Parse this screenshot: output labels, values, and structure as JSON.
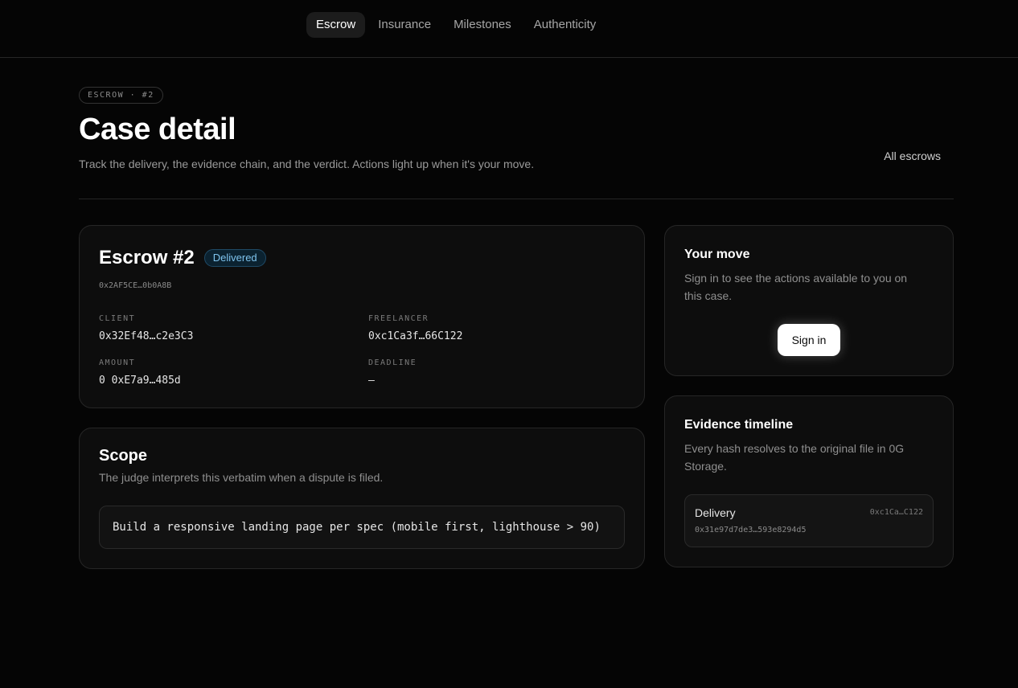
{
  "nav": {
    "tabs": [
      {
        "label": "Escrow",
        "active": true
      },
      {
        "label": "Insurance",
        "active": false
      },
      {
        "label": "Milestones",
        "active": false
      },
      {
        "label": "Authenticity",
        "active": false
      }
    ]
  },
  "header": {
    "badge": "ESCROW · #2",
    "title": "Case detail",
    "subtitle": "Track the delivery, the evidence chain, and the verdict. Actions light up when it's your move.",
    "all_link": "All escrows"
  },
  "escrow": {
    "title": "Escrow #2",
    "status": "Delivered",
    "address": "0x2AF5CE…0b0A8B",
    "client_label": "CLIENT",
    "client_value": "0x32Ef48…c2e3C3",
    "freelancer_label": "FREELANCER",
    "freelancer_value": "0xc1Ca3f…66C122",
    "amount_label": "AMOUNT",
    "amount_value": "0 0xE7a9…485d",
    "deadline_label": "DEADLINE",
    "deadline_value": "—"
  },
  "scope": {
    "title": "Scope",
    "description": "The judge interprets this verbatim when a dispute is filed.",
    "text": "Build a responsive landing page per spec (mobile first, lighthouse > 90)"
  },
  "your_move": {
    "title": "Your move",
    "description": "Sign in to see the actions available to you on this case.",
    "button": "Sign in"
  },
  "evidence": {
    "title": "Evidence timeline",
    "description": "Every hash resolves to the original file in 0G Storage.",
    "items": [
      {
        "label": "Delivery",
        "actor": "0xc1Ca…C122",
        "hash": "0x31e97d7de3…593e8294d5"
      }
    ]
  },
  "colors": {
    "background": "#050505",
    "card": "#0d0d0d",
    "status_accent": "#7fc4ee"
  }
}
